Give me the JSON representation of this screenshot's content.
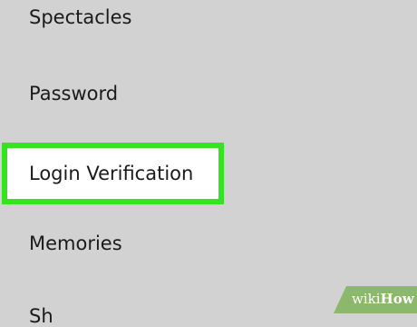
{
  "settings": {
    "items": [
      {
        "label": "Spectacles"
      },
      {
        "label": "Password"
      },
      {
        "label": "Login Verification",
        "highlighted": true
      },
      {
        "label": "Memories"
      },
      {
        "label": "Sh"
      }
    ]
  },
  "colors": {
    "background": "#d2d2d2",
    "highlight_border": "#35e320",
    "highlight_fill": "#ffffff",
    "text": "#1a1a1a",
    "watermark_green": "#8bb86b"
  },
  "watermark": {
    "wiki": "wiki",
    "how": "How"
  }
}
